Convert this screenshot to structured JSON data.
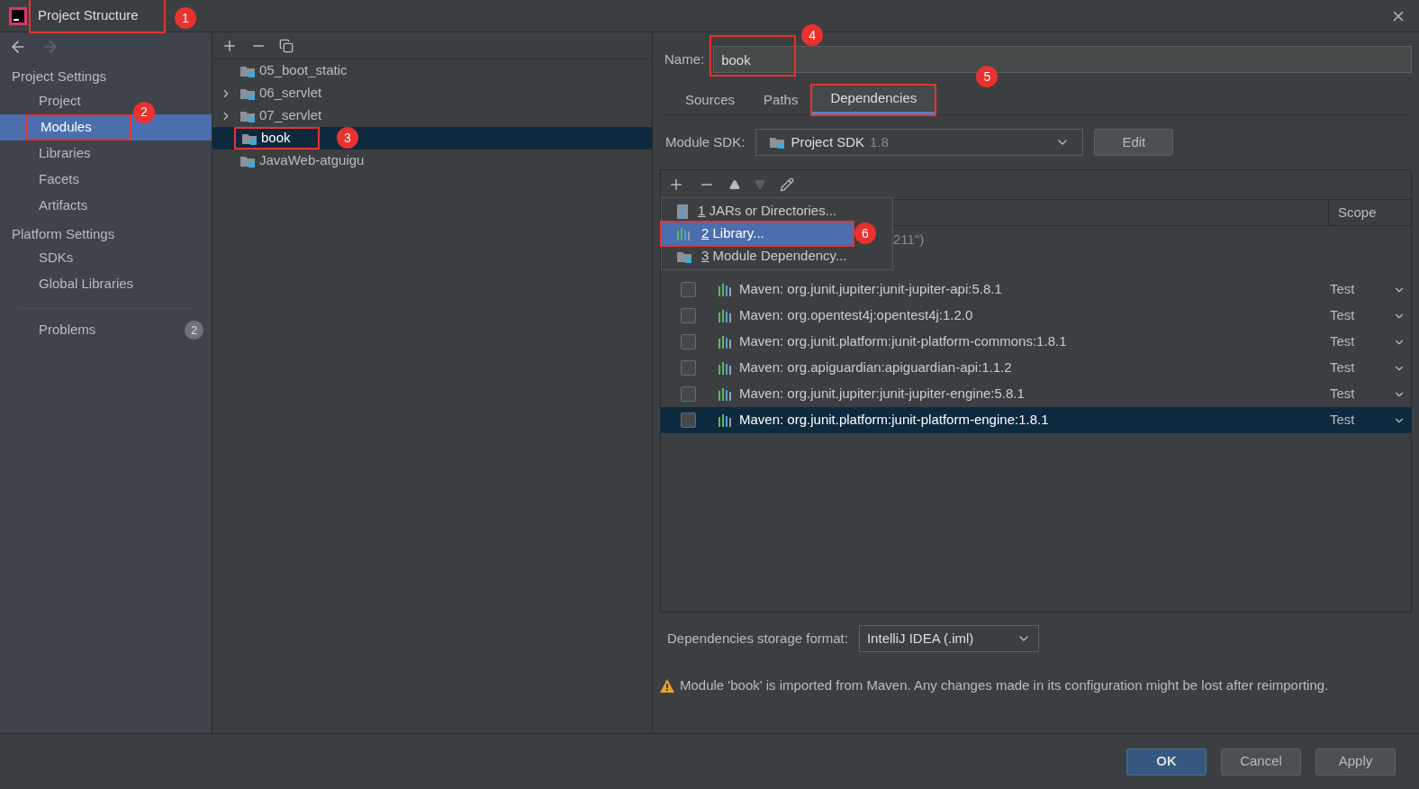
{
  "window": {
    "title": "Project Structure",
    "callout": "1"
  },
  "sidebar": {
    "sections": [
      {
        "heading": "Project Settings",
        "items": [
          {
            "label": "Project",
            "selected": false
          },
          {
            "label": "Modules",
            "selected": true,
            "callout": "2"
          },
          {
            "label": "Libraries",
            "selected": false
          },
          {
            "label": "Facets",
            "selected": false
          },
          {
            "label": "Artifacts",
            "selected": false
          }
        ]
      },
      {
        "heading": "Platform Settings",
        "items": [
          {
            "label": "SDKs",
            "selected": false
          },
          {
            "label": "Global Libraries",
            "selected": false
          }
        ]
      }
    ],
    "problems": {
      "label": "Problems",
      "count": "2"
    }
  },
  "module_tree": [
    {
      "label": "05_boot_static",
      "expandable": false,
      "selected": false
    },
    {
      "label": "06_servlet",
      "expandable": true,
      "selected": false
    },
    {
      "label": "07_servlet",
      "expandable": true,
      "selected": false
    },
    {
      "label": "book",
      "expandable": false,
      "selected": true,
      "callout": "3"
    },
    {
      "label": "JavaWeb-atguigu",
      "expandable": false,
      "selected": false
    }
  ],
  "name_field": {
    "label": "Name:",
    "value": "book",
    "callout": "4"
  },
  "tabs": [
    {
      "label": "Sources",
      "selected": false
    },
    {
      "label": "Paths",
      "selected": false
    },
    {
      "label": "Dependencies",
      "selected": true,
      "callout": "5"
    }
  ],
  "module_sdk": {
    "label": "Module SDK:",
    "value": "Project SDK",
    "version": "1.8",
    "button": "Edit"
  },
  "add_menu": [
    {
      "key": "1",
      "label": "JARs or Directories...",
      "kind": "jar",
      "selected": false
    },
    {
      "key": "2",
      "label": "Library...",
      "kind": "library",
      "selected": true,
      "callout": "6"
    },
    {
      "key": "3",
      "label": "Module Dependency...",
      "kind": "module",
      "selected": false
    }
  ],
  "dependencies": {
    "scope_column": "Scope",
    "partial_row": "211\")",
    "rows": [
      {
        "name": "Maven: org.junit.jupiter:junit-jupiter-api:5.8.1",
        "scope": "Test",
        "checked": false,
        "selected": false
      },
      {
        "name": "Maven: org.opentest4j:opentest4j:1.2.0",
        "scope": "Test",
        "checked": false,
        "selected": false
      },
      {
        "name": "Maven: org.junit.platform:junit-platform-commons:1.8.1",
        "scope": "Test",
        "checked": false,
        "selected": false
      },
      {
        "name": "Maven: org.apiguardian:apiguardian-api:1.1.2",
        "scope": "Test",
        "checked": false,
        "selected": false
      },
      {
        "name": "Maven: org.junit.jupiter:junit-jupiter-engine:5.8.1",
        "scope": "Test",
        "checked": false,
        "selected": false
      },
      {
        "name": "Maven: org.junit.platform:junit-platform-engine:1.8.1",
        "scope": "Test",
        "checked": false,
        "selected": true
      }
    ]
  },
  "storage_format": {
    "label": "Dependencies storage format:",
    "value": "IntelliJ IDEA (.iml)"
  },
  "warning": "Module 'book' is imported from Maven. Any changes made in its configuration might be lost after reimporting.",
  "buttons": [
    {
      "label": "OK",
      "kind": "primary"
    },
    {
      "label": "Cancel",
      "kind": "secondary"
    },
    {
      "label": "Apply",
      "kind": "secondary"
    }
  ]
}
